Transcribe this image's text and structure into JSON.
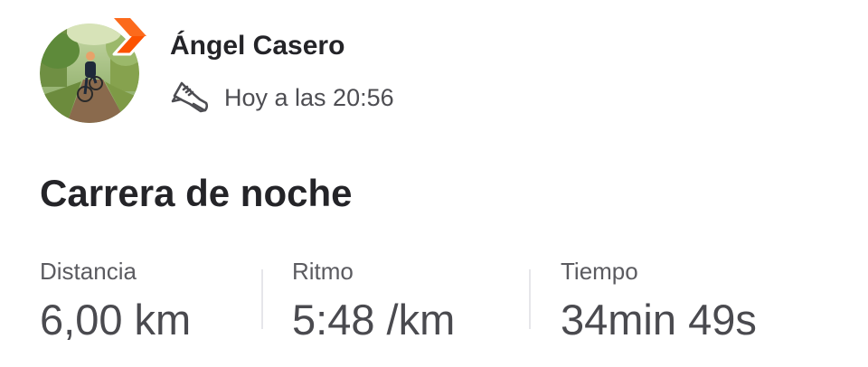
{
  "athlete": {
    "name": "Ángel Casero",
    "avatar_icon": "cyclist-photo-avatar",
    "badge_icon": "strava-chevron-icon",
    "badge_color": "#fc5200"
  },
  "activity": {
    "sport_icon": "running-shoe-icon",
    "timestamp": "Hoy a las 20:56",
    "title": "Carrera de noche"
  },
  "stats": [
    {
      "label": "Distancia",
      "value": "6,00 km"
    },
    {
      "label": "Ritmo",
      "value": "5:48 /km"
    },
    {
      "label": "Tiempo",
      "value": "34min 49s"
    }
  ],
  "colors": {
    "text_primary": "#242428",
    "text_secondary": "#4d4d52",
    "divider": "#e6e6ea"
  }
}
